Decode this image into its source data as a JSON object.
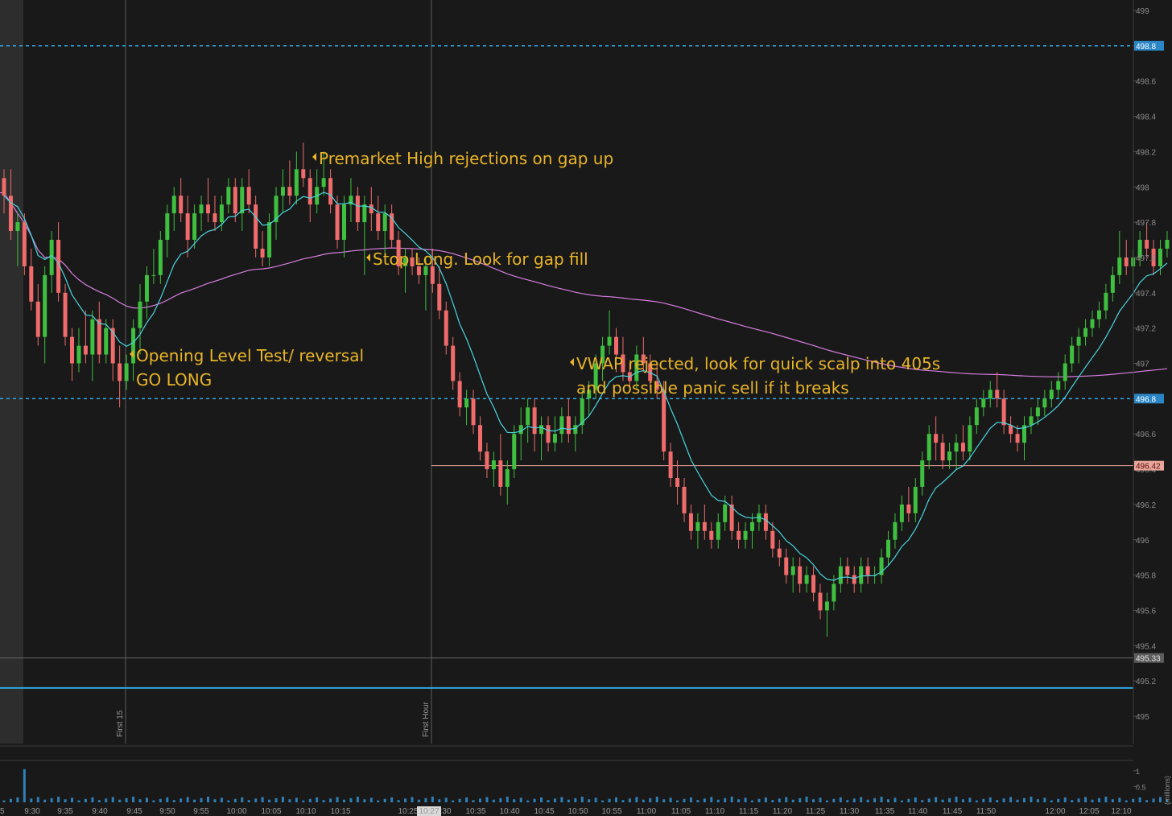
{
  "chart_data": {
    "type": "candlestick",
    "interval_minutes": 1,
    "y_range": [
      494.85,
      499.03
    ],
    "price_ticks": [
      "499",
      "498.8",
      "498.6",
      "498.4",
      "498.2",
      "498",
      "497.8",
      "497.6",
      "497.4",
      "497.2",
      "497",
      "496.8",
      "496.6",
      "496.4",
      "496.2",
      "496",
      "495.8",
      "495.6",
      "495.4",
      "495.2",
      "495"
    ],
    "time_ticks": [
      "9:30",
      "9:35",
      "9:40",
      "9:45",
      "9:50",
      "9:55",
      "10:00",
      "10:05",
      "10:10",
      "10:15",
      "10:25",
      "10:30",
      "10:35",
      "10:40",
      "10:45",
      "10:50",
      "10:55",
      "11:00",
      "11:05",
      "11:10",
      "11:15",
      "11:20",
      "11:25",
      "11:30",
      "11:35",
      "11:40",
      "11:45",
      "11:50",
      "12:00",
      "12:05",
      "12:10"
    ],
    "left_edge_label": "5",
    "horizontal_levels": [
      {
        "price": 498.8,
        "label": "498.8",
        "color": "#2fa7e0",
        "style": "dashed"
      },
      {
        "price": 496.8,
        "label": "496.8",
        "color": "#2fa7e0",
        "style": "dashed"
      },
      {
        "price": 496.42,
        "label": "496.42",
        "color": "#e8a59a",
        "style": "solid"
      },
      {
        "price": 495.33,
        "label": "495.33",
        "color": "#666666",
        "style": "solid"
      },
      {
        "price": 495.16,
        "label": "",
        "color": "#2fa7e0",
        "style": "solid"
      }
    ],
    "vertical_markers": [
      {
        "label": "First 15"
      },
      {
        "label": "First Hour"
      }
    ],
    "cursor_time_label": "10:27",
    "annotations": [
      {
        "lines": [
          "Premarket High rejections on gap up"
        ]
      },
      {
        "lines": [
          "Stop Long.  Look for gap fill"
        ]
      },
      {
        "lines": [
          "Opening Level Test/ reversal",
          "GO LONG"
        ]
      },
      {
        "lines": [
          "VWAP rejected, look for quick scalp into 405s",
          " and possible panic sell if it breaks"
        ]
      }
    ],
    "candles": [
      [
        498.05,
        498.1,
        497.85,
        497.95
      ],
      [
        497.95,
        498.1,
        497.7,
        497.75
      ],
      [
        497.75,
        497.85,
        497.55,
        497.8
      ],
      [
        497.8,
        497.85,
        497.5,
        497.55
      ],
      [
        497.55,
        497.65,
        497.3,
        497.35
      ],
      [
        497.35,
        497.45,
        497.1,
        497.15
      ],
      [
        497.15,
        497.55,
        497.0,
        497.5
      ],
      [
        497.5,
        497.75,
        497.4,
        497.7
      ],
      [
        497.7,
        497.8,
        497.35,
        497.4
      ],
      [
        497.4,
        497.45,
        497.1,
        497.15
      ],
      [
        497.15,
        497.2,
        496.9,
        497.0
      ],
      [
        497.0,
        497.2,
        496.95,
        497.1
      ],
      [
        497.1,
        497.3,
        497.0,
        497.05
      ],
      [
        497.05,
        497.3,
        496.9,
        497.25
      ],
      [
        497.25,
        497.35,
        497.0,
        497.05
      ],
      [
        497.05,
        497.25,
        497.0,
        497.2
      ],
      [
        497.2,
        497.25,
        496.9,
        497.0
      ],
      [
        497.0,
        497.1,
        496.75,
        496.9
      ],
      [
        496.9,
        497.05,
        496.85,
        497.0
      ],
      [
        497.0,
        497.25,
        496.9,
        497.2
      ],
      [
        497.2,
        497.45,
        497.05,
        497.35
      ],
      [
        497.35,
        497.55,
        497.25,
        497.5
      ],
      [
        497.5,
        497.65,
        497.45,
        497.5
      ],
      [
        497.5,
        497.75,
        497.45,
        497.7
      ],
      [
        497.7,
        497.9,
        497.6,
        497.85
      ],
      [
        497.85,
        498.0,
        497.75,
        497.95
      ],
      [
        497.95,
        498.05,
        497.8,
        497.85
      ],
      [
        497.85,
        497.95,
        497.6,
        497.7
      ],
      [
        497.7,
        497.9,
        497.65,
        497.85
      ],
      [
        497.85,
        497.95,
        497.75,
        497.9
      ],
      [
        497.9,
        498.05,
        497.8,
        497.85
      ],
      [
        497.85,
        497.95,
        497.75,
        497.8
      ],
      [
        497.8,
        497.95,
        497.75,
        497.9
      ],
      [
        497.9,
        498.05,
        497.85,
        498.0
      ],
      [
        498.0,
        498.05,
        497.8,
        497.85
      ],
      [
        497.85,
        498.05,
        497.75,
        498.0
      ],
      [
        498.0,
        498.1,
        497.85,
        497.9
      ],
      [
        497.9,
        497.95,
        497.6,
        497.65
      ],
      [
        497.65,
        497.75,
        497.55,
        497.6
      ],
      [
        497.6,
        497.85,
        497.55,
        497.8
      ],
      [
        497.8,
        498.0,
        497.7,
        497.95
      ],
      [
        497.95,
        498.1,
        497.85,
        498.0
      ],
      [
        498.0,
        498.15,
        497.9,
        497.95
      ],
      [
        497.95,
        498.2,
        497.9,
        498.1
      ],
      [
        498.1,
        498.25,
        498.0,
        498.05
      ],
      [
        498.05,
        498.1,
        497.8,
        497.9
      ],
      [
        497.9,
        498.1,
        497.85,
        498.0
      ],
      [
        498.0,
        498.2,
        497.95,
        498.05
      ],
      [
        498.05,
        498.1,
        497.85,
        497.9
      ],
      [
        497.9,
        497.95,
        497.65,
        497.7
      ],
      [
        497.7,
        497.95,
        497.6,
        497.9
      ],
      [
        497.9,
        498.05,
        497.8,
        497.95
      ],
      [
        497.95,
        498.0,
        497.75,
        497.8
      ],
      [
        497.8,
        497.95,
        497.5,
        497.9
      ],
      [
        497.9,
        498.0,
        497.75,
        497.85
      ],
      [
        497.85,
        497.95,
        497.7,
        497.75
      ],
      [
        497.75,
        497.9,
        497.6,
        497.85
      ],
      [
        497.85,
        497.9,
        497.65,
        497.7
      ],
      [
        497.7,
        497.75,
        497.5,
        497.55
      ],
      [
        497.55,
        497.65,
        497.4,
        497.6
      ],
      [
        497.6,
        497.65,
        497.5,
        497.55
      ],
      [
        497.55,
        497.6,
        497.45,
        497.5
      ],
      [
        497.5,
        497.6,
        497.3,
        497.55
      ],
      [
        497.55,
        497.65,
        497.4,
        497.45
      ],
      [
        497.45,
        497.55,
        497.25,
        497.3
      ],
      [
        497.3,
        497.35,
        497.05,
        497.1
      ],
      [
        497.1,
        497.15,
        496.85,
        496.9
      ],
      [
        496.9,
        496.95,
        496.7,
        496.75
      ],
      [
        496.75,
        496.85,
        496.65,
        496.8
      ],
      [
        496.8,
        496.85,
        496.6,
        496.65
      ],
      [
        496.65,
        496.7,
        496.45,
        496.5
      ],
      [
        496.5,
        496.55,
        496.35,
        496.4
      ],
      [
        496.4,
        496.5,
        496.3,
        496.45
      ],
      [
        496.45,
        496.6,
        496.25,
        496.3
      ],
      [
        496.3,
        496.45,
        496.2,
        496.4
      ],
      [
        496.4,
        496.65,
        496.35,
        496.6
      ],
      [
        496.6,
        496.75,
        496.45,
        496.65
      ],
      [
        496.65,
        496.8,
        496.55,
        496.75
      ],
      [
        496.75,
        496.8,
        496.5,
        496.6
      ],
      [
        496.6,
        496.7,
        496.45,
        496.65
      ],
      [
        496.65,
        496.7,
        496.5,
        496.55
      ],
      [
        496.55,
        496.7,
        496.5,
        496.6
      ],
      [
        496.6,
        496.75,
        496.55,
        496.7
      ],
      [
        496.7,
        496.8,
        496.55,
        496.6
      ],
      [
        496.6,
        496.7,
        496.5,
        496.65
      ],
      [
        496.65,
        496.85,
        496.6,
        496.8
      ],
      [
        496.8,
        496.9,
        496.7,
        496.85
      ],
      [
        496.85,
        497.05,
        496.8,
        497.0
      ],
      [
        497.0,
        497.15,
        496.9,
        497.1
      ],
      [
        497.1,
        497.3,
        497.05,
        497.15
      ],
      [
        497.15,
        497.2,
        496.95,
        497.05
      ],
      [
        497.05,
        497.15,
        496.9,
        496.95
      ],
      [
        496.95,
        497.0,
        496.85,
        496.9
      ],
      [
        496.9,
        497.1,
        496.85,
        497.05
      ],
      [
        497.05,
        497.15,
        496.95,
        497.0
      ],
      [
        497.0,
        497.05,
        496.85,
        496.9
      ],
      [
        496.9,
        497.0,
        496.8,
        496.85
      ],
      [
        496.85,
        496.9,
        496.45,
        496.5
      ],
      [
        496.5,
        496.55,
        496.3,
        496.35
      ],
      [
        496.35,
        496.45,
        496.2,
        496.3
      ],
      [
        496.3,
        496.35,
        496.1,
        496.15
      ],
      [
        496.15,
        496.2,
        496.0,
        496.05
      ],
      [
        496.05,
        496.15,
        495.95,
        496.1
      ],
      [
        496.1,
        496.2,
        496.0,
        496.05
      ],
      [
        496.05,
        496.1,
        495.95,
        496.0
      ],
      [
        496.0,
        496.15,
        495.95,
        496.1
      ],
      [
        496.1,
        496.25,
        496.05,
        496.2
      ],
      [
        496.2,
        496.25,
        496.0,
        496.05
      ],
      [
        496.05,
        496.1,
        495.95,
        496.0
      ],
      [
        496.0,
        496.1,
        495.95,
        496.05
      ],
      [
        496.05,
        496.15,
        495.95,
        496.1
      ],
      [
        496.1,
        496.2,
        496.05,
        496.15
      ],
      [
        496.15,
        496.2,
        496.0,
        496.05
      ],
      [
        496.05,
        496.1,
        495.9,
        495.95
      ],
      [
        495.95,
        496.0,
        495.85,
        495.9
      ],
      [
        495.9,
        495.95,
        495.75,
        495.8
      ],
      [
        495.8,
        495.9,
        495.7,
        495.85
      ],
      [
        495.85,
        495.9,
        495.7,
        495.75
      ],
      [
        495.75,
        495.85,
        495.7,
        495.8
      ],
      [
        495.8,
        495.85,
        495.65,
        495.7
      ],
      [
        495.7,
        495.75,
        495.55,
        495.6
      ],
      [
        495.6,
        495.7,
        495.45,
        495.65
      ],
      [
        495.65,
        495.8,
        495.6,
        495.75
      ],
      [
        495.75,
        495.9,
        495.7,
        495.85
      ],
      [
        495.85,
        495.9,
        495.75,
        495.8
      ],
      [
        495.8,
        495.85,
        495.7,
        495.75
      ],
      [
        495.75,
        495.9,
        495.7,
        495.85
      ],
      [
        495.85,
        495.9,
        495.75,
        495.8
      ],
      [
        495.8,
        495.85,
        495.75,
        495.8
      ],
      [
        495.8,
        495.95,
        495.75,
        495.9
      ],
      [
        495.9,
        496.05,
        495.85,
        496.0
      ],
      [
        496.0,
        496.15,
        495.95,
        496.1
      ],
      [
        496.1,
        496.25,
        496.05,
        496.2
      ],
      [
        496.2,
        496.3,
        496.1,
        496.15
      ],
      [
        496.15,
        496.35,
        496.1,
        496.3
      ],
      [
        496.3,
        496.5,
        496.25,
        496.45
      ],
      [
        496.45,
        496.65,
        496.4,
        496.6
      ],
      [
        496.6,
        496.7,
        496.45,
        496.55
      ],
      [
        496.55,
        496.6,
        496.4,
        496.45
      ],
      [
        496.45,
        496.55,
        496.4,
        496.5
      ],
      [
        496.5,
        496.6,
        496.4,
        496.55
      ],
      [
        496.55,
        496.65,
        496.45,
        496.5
      ],
      [
        496.5,
        496.7,
        496.45,
        496.65
      ],
      [
        496.65,
        496.8,
        496.6,
        496.75
      ],
      [
        496.75,
        496.85,
        496.7,
        496.8
      ],
      [
        496.8,
        496.9,
        496.75,
        496.85
      ],
      [
        496.85,
        496.95,
        496.75,
        496.8
      ],
      [
        496.8,
        496.85,
        496.6,
        496.65
      ],
      [
        496.65,
        496.7,
        496.55,
        496.6
      ],
      [
        496.6,
        496.65,
        496.5,
        496.55
      ],
      [
        496.55,
        496.7,
        496.45,
        496.65
      ],
      [
        496.65,
        496.75,
        496.6,
        496.7
      ],
      [
        496.7,
        496.8,
        496.65,
        496.75
      ],
      [
        496.75,
        496.85,
        496.7,
        496.8
      ],
      [
        496.8,
        496.9,
        496.75,
        496.85
      ],
      [
        496.85,
        496.95,
        496.8,
        496.9
      ],
      [
        496.9,
        497.05,
        496.85,
        497.0
      ],
      [
        497.0,
        497.15,
        496.95,
        497.1
      ],
      [
        497.1,
        497.2,
        497.0,
        497.15
      ],
      [
        497.15,
        497.25,
        497.1,
        497.2
      ],
      [
        497.2,
        497.3,
        497.15,
        497.25
      ],
      [
        497.25,
        497.35,
        497.2,
        497.3
      ],
      [
        497.3,
        497.45,
        497.25,
        497.4
      ],
      [
        497.4,
        497.55,
        497.35,
        497.5
      ],
      [
        497.5,
        497.75,
        497.45,
        497.6
      ],
      [
        497.6,
        497.7,
        497.5,
        497.55
      ],
      [
        497.55,
        497.65,
        497.45,
        497.6
      ],
      [
        497.6,
        497.75,
        497.55,
        497.7
      ],
      [
        497.7,
        497.8,
        497.6,
        497.65
      ],
      [
        497.65,
        497.7,
        497.5,
        497.55
      ],
      [
        497.55,
        497.7,
        497.5,
        497.65
      ],
      [
        497.65,
        497.75,
        497.6,
        497.7
      ]
    ],
    "volume_ticks": [
      "1",
      "0.5"
    ],
    "volume_scale": 1.25,
    "volume_peak": 1.05,
    "volume_base": 0.06,
    "volume_axis_label": "(millions)",
    "colors": {
      "up": "#3fbf3f",
      "down": "#f06b6b",
      "ema": "#49d6e0",
      "vwap": "#d77ee0",
      "annotation": "#e8b428",
      "volume": "#2f80b8",
      "background": "#191919",
      "premarket_shade": "#2d2d2d"
    }
  }
}
